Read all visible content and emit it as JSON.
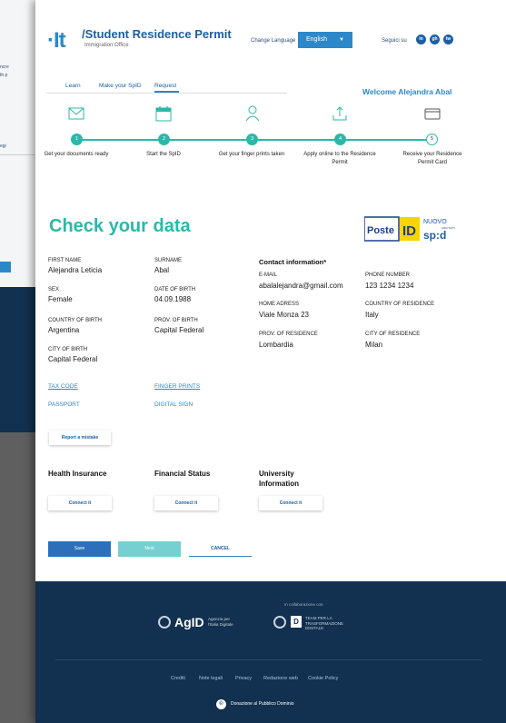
{
  "background_window": {
    "line1": "ncre",
    "line2": "th p",
    "line3": "egi"
  },
  "header": {
    "logo": "·It",
    "title": "/Student Residence Permit",
    "subtitle": "Immigration Office",
    "change_language": "Change Language",
    "language": "English",
    "follow": "Seguici su",
    "social": [
      "in",
      "gh",
      "tw"
    ]
  },
  "nav": {
    "tabs": [
      "Learn",
      "Make your SpID",
      "Request"
    ],
    "active_tab": "Request",
    "welcome": "Welcome Alejandra Abal"
  },
  "steps": [
    {
      "number": "1",
      "label": "Get your documents ready",
      "icon": "envelope-icon",
      "done": true
    },
    {
      "number": "2",
      "label": "Start the SpID",
      "icon": "calendar-icon",
      "done": true
    },
    {
      "number": "3",
      "label": "Get your finger prints taken",
      "icon": "person-icon",
      "done": true
    },
    {
      "number": "4",
      "label": "Apply online to the Residence Permit",
      "icon": "upload-icon",
      "done": true
    },
    {
      "number": "5",
      "label": "Receive your Residence Permit Card",
      "icon": "card-icon",
      "done": false
    }
  ],
  "main": {
    "title": "Check your data",
    "spid": {
      "poste": "Poste",
      "id": "ID",
      "nuovo": "NUOVO",
      "abilitato": "ABILITATO",
      "spid": "sp:d"
    }
  },
  "personal": {
    "first_name_label": "FIRST NAME",
    "first_name": "Alejandra Leticia",
    "surname_label": "SURNAME",
    "surname": "Abal",
    "sex_label": "SEX",
    "sex": "Female",
    "dob_label": "DATE OF BIRTH",
    "dob": "04.09.1988",
    "country_birth_label": "COUNTRY OF BIRTH",
    "country_birth": "Argentina",
    "prov_birth_label": "PROV. OF BIRTH",
    "prov_birth": "Capital Federal",
    "city_birth_label": "CITY OF BIRTH",
    "city_birth": "Capital Federal"
  },
  "contact": {
    "heading": "Contact information*",
    "email_label": "E-MAIL",
    "email": "abalalejandra@gmail.com",
    "phone_label": "PHONE NUMBER",
    "phone": "123 1234 1234",
    "address_label": "HOME ADRESS",
    "address": "Viale Monza 23",
    "country_res_label": "COUNTRY OF RESIDENCE",
    "country_res": "Italy",
    "prov_res_label": "PROV. OF RESIDENCE",
    "prov_res": "Lombardia",
    "city_res_label": "CITY OF RESIDENCE",
    "city_res": "Milan"
  },
  "documents": {
    "tax_code": "TAX CODE",
    "finger_prints": "FINGER PRINTS",
    "passport": "PASSPORT",
    "digital_sign": "DIGITAL SIGN"
  },
  "report_button": "Report a mistake",
  "sections": {
    "health": "Health Insurance",
    "financial": "Financial Status",
    "university": "University Information",
    "connect_label": "Connect it"
  },
  "actions": {
    "save": "Save",
    "next": "Next",
    "cancel": "CANCEL"
  },
  "footer": {
    "collab": "In collaborazione con",
    "agid": "AgID",
    "agid_sub1": "Agenzia per",
    "agid_sub2": "l'Italia Digitale",
    "team_d": "D",
    "team_sub1": "TEAM PER LA",
    "team_sub2": "TRASFORMAZIONE",
    "team_sub3": "DIGITALE",
    "links": [
      "Crediti",
      "Note legali",
      "Privacy",
      "Redazione web",
      "Cookie Policy"
    ],
    "cc_icon": "©",
    "cc_text": "Donazione al Pubblico Dominio"
  },
  "colors": {
    "primary": "#2d88c9",
    "teal": "#2bb8a8",
    "footer": "#12304f"
  }
}
